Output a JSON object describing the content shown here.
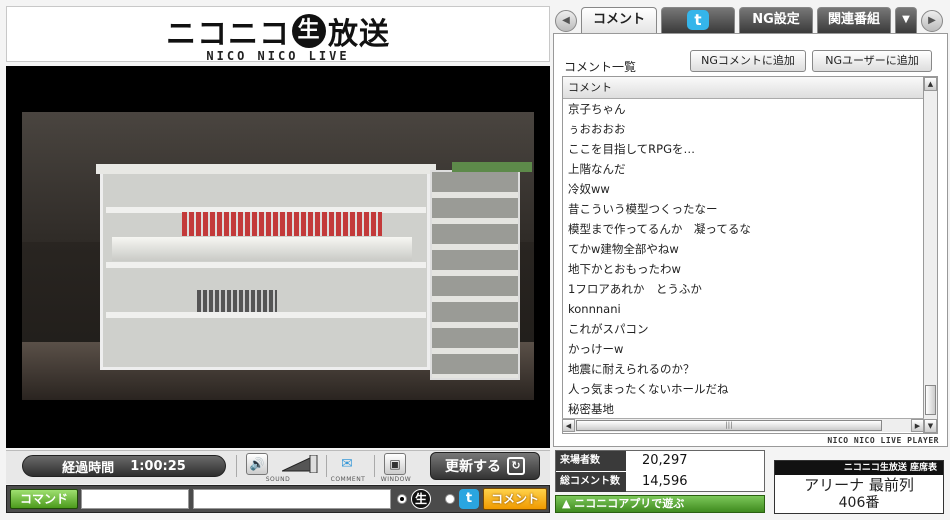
{
  "logo": {
    "main_left": "ニコニコ",
    "nama": "生",
    "main_right": "放送",
    "sub": "NICO NICO LIVE"
  },
  "player": {
    "elapsed_label": "経過時間",
    "elapsed_time": "1:00:25",
    "sound_label": "SOUND",
    "comment_toggle_label": "COMMENT",
    "window_label": "WINDOW",
    "refresh_label": "更新する"
  },
  "command_bar": {
    "command_label": "コマンド",
    "command_value": "",
    "comment_value": "",
    "nama_icon": "生",
    "twitter_icon": "t",
    "submit_label": "コメント"
  },
  "tabs": [
    {
      "label": "コメント",
      "active": true
    },
    {
      "label": "twitter-icon",
      "active": false
    },
    {
      "label": "NG設定",
      "active": false
    },
    {
      "label": "関連番組",
      "active": false
    }
  ],
  "tab_twitter_glyph": "t",
  "comment_panel": {
    "list_title": "コメント一覧",
    "ng_comment_button": "NGコメントに追加",
    "ng_user_button": "NGユーザーに追加",
    "column_header": "コメント",
    "comments": [
      "京子ちゃん",
      "ぅおおおお",
      "ここを目指してRPGを…",
      "上階なんだ",
      "冷奴ww",
      "昔こういう模型つくったなー",
      "模型まで作ってるんか　凝ってるな",
      "てかw建物全部やねw",
      "地下かとおもったわw",
      "1フロアあれか　とうふか",
      "konnnani",
      "これがスパコン",
      "かっけーw",
      "地震に耐えられるのか？",
      "人っ気まったくないホールだね",
      "秘密基地"
    ],
    "hthumb_grip": "|||",
    "player_label": "NICO NICO LIVE PLAYER"
  },
  "stats": {
    "visitors_label": "来場者数",
    "visitors_value": "20,297",
    "comments_label": "総コメント数",
    "comments_value": "14,596"
  },
  "app_link": "ニコニコアプリで遊ぶ",
  "ticket": {
    "header": "ニコニコ生放送 座席表",
    "seat": "アリーナ 最前列",
    "number": "406番"
  }
}
